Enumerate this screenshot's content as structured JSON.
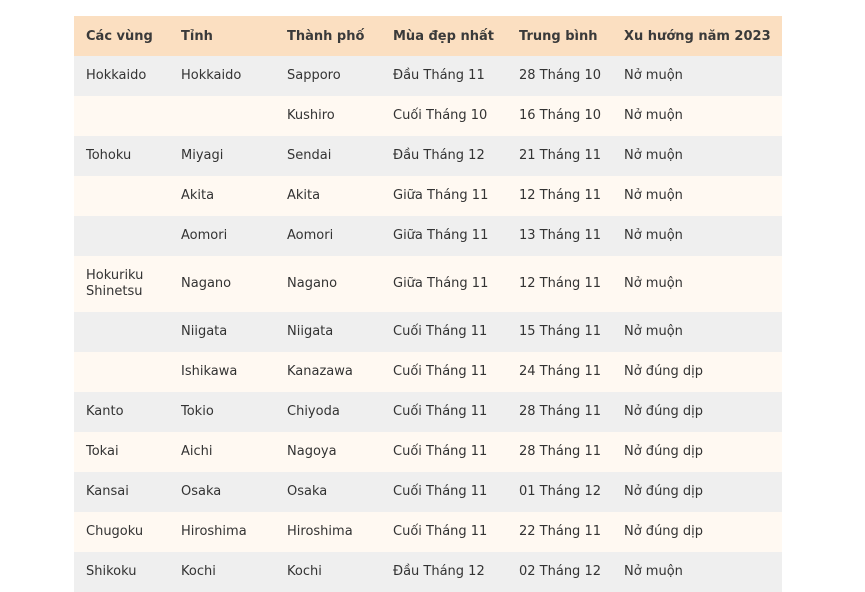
{
  "table": {
    "headers": [
      "Các vùng",
      "Tỉnh",
      "Thành phố",
      "Mùa đẹp nhất",
      "Trung bình",
      "Xu hướng năm 2023"
    ],
    "rows": [
      [
        "Hokkaido",
        "Hokkaido",
        "Sapporo",
        "Đầu Tháng 11",
        "28 Tháng 10",
        "Nở muộn"
      ],
      [
        "",
        "",
        "Kushiro",
        "Cuối Tháng 10",
        "16 Tháng 10",
        "Nở muộn"
      ],
      [
        "Tohoku",
        "Miyagi",
        "Sendai",
        "Đầu Tháng 12",
        "21 Tháng 11",
        "Nở muộn"
      ],
      [
        "",
        "Akita",
        "Akita",
        "Giữa Tháng 11",
        "12 Tháng 11",
        "Nở muộn"
      ],
      [
        "",
        "Aomori",
        "Aomori",
        "Giữa Tháng 11",
        "13 Tháng 11",
        "Nở muộn"
      ],
      [
        "Hokuriku Shinetsu",
        "Nagano",
        "Nagano",
        "Giữa Tháng 11",
        "12 Tháng 11",
        "Nở muộn"
      ],
      [
        "",
        "Niigata",
        "Niigata",
        "Cuối Tháng 11",
        "15 Tháng 11",
        "Nở muộn"
      ],
      [
        "",
        "Ishikawa",
        "Kanazawa",
        "Cuối Tháng 11",
        "24 Tháng 11",
        "Nở đúng dịp"
      ],
      [
        "Kanto",
        "Tokio",
        "Chiyoda",
        "Cuối Tháng 11",
        "28 Tháng 11",
        "Nở đúng dịp"
      ],
      [
        "Tokai",
        "Aichi",
        "Nagoya",
        "Cuối Tháng 11",
        "28 Tháng 11",
        "Nở đúng dịp"
      ],
      [
        "Kansai",
        "Osaka",
        "Osaka",
        "Cuối Tháng 11",
        "01 Tháng 12",
        "Nở đúng dịp"
      ],
      [
        "Chugoku",
        "Hiroshima",
        "Hiroshima",
        "Cuối Tháng 11",
        "22 Tháng 11",
        "Nở đúng dịp"
      ],
      [
        "Shikoku",
        "Kochi",
        "Kochi",
        "Đầu Tháng 12",
        "02 Tháng 12",
        "Nở muộn"
      ]
    ]
  },
  "colors": {
    "header_bg": "#fbdfc1",
    "row_odd_bg": "#efefef",
    "row_even_bg": "#fff9f2",
    "text": "#333333"
  }
}
